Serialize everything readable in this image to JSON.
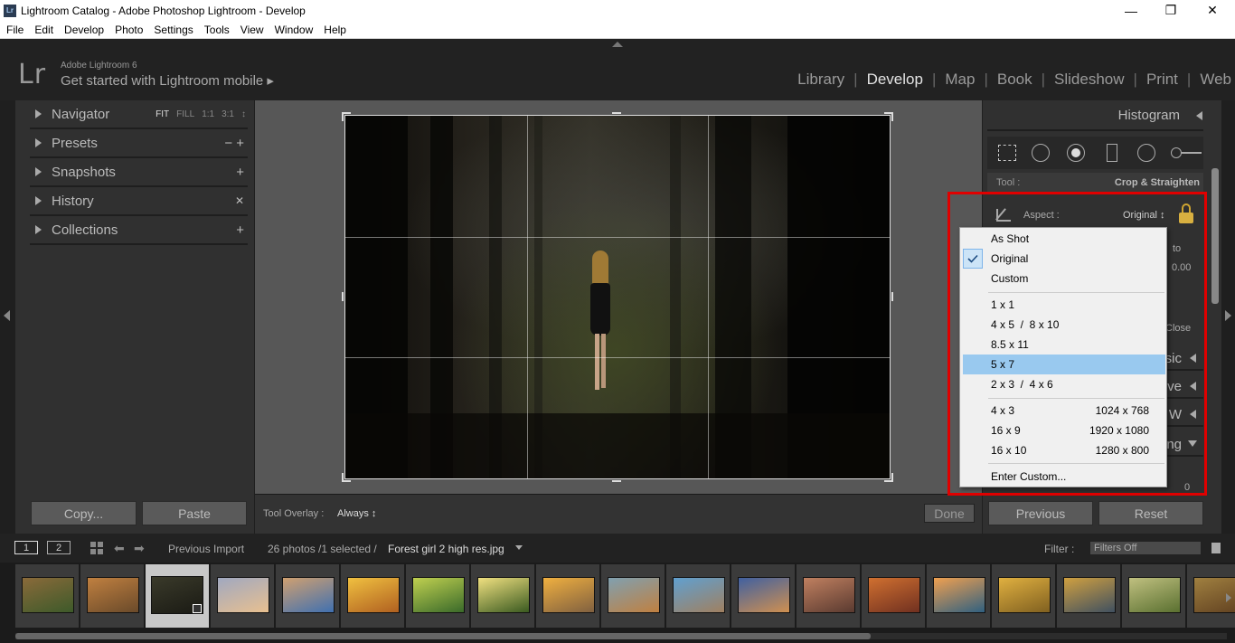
{
  "window": {
    "icon_text": "Lr",
    "title": "Lightroom Catalog - Adobe Photoshop Lightroom - Develop",
    "minimize": "—",
    "restore": "❐",
    "close": "✕"
  },
  "menu": [
    "File",
    "Edit",
    "Develop",
    "Photo",
    "Settings",
    "Tools",
    "View",
    "Window",
    "Help"
  ],
  "header": {
    "logo": "Lr",
    "brand": "Adobe Lightroom 6",
    "mobile_link": "Get started with Lightroom mobile ▸",
    "modules": [
      "Library",
      "Develop",
      "Map",
      "Book",
      "Slideshow",
      "Print",
      "Web"
    ],
    "active_module": "Develop"
  },
  "left_panel": {
    "navigator": {
      "label": "Navigator",
      "zoom": [
        "FIT",
        "FILL",
        "1:1",
        "3:1"
      ],
      "zoom_arrow": "↕"
    },
    "presets": {
      "label": "Presets",
      "actions": "−  +"
    },
    "snapshots": {
      "label": "Snapshots",
      "actions": "+"
    },
    "history": {
      "label": "History",
      "actions": "✕"
    },
    "collections": {
      "label": "Collections",
      "actions": "+"
    },
    "copy_button": "Copy...",
    "paste_button": "Paste"
  },
  "toolbar": {
    "overlay_label": "Tool Overlay :",
    "overlay_value": "Always ↕",
    "done_button": "Done"
  },
  "right_panel": {
    "histogram": "Histogram",
    "tool_label": "Tool :",
    "tool_name": "Crop & Straighten",
    "aspect_label": "Aspect :",
    "aspect_value": "Original ↕",
    "partial_to": "to",
    "partial_angle": "0.00",
    "partial_close": "Close",
    "partial_sections": [
      "sic",
      "ve",
      "W",
      "ng"
    ],
    "partial_value": "0",
    "previous_button": "Previous",
    "reset_button": "Reset"
  },
  "aspect_dropdown": {
    "group1": [
      {
        "label": "As Shot",
        "checked": false
      },
      {
        "label": "Original",
        "checked": true
      },
      {
        "label": "Custom",
        "checked": false
      }
    ],
    "group2": [
      {
        "label": "1 x 1"
      },
      {
        "label": "4 x 5  /  8 x 10"
      },
      {
        "label": "8.5 x 11"
      },
      {
        "label": "5 x 7",
        "highlighted": true
      },
      {
        "label": "2 x 3  /  4 x 6"
      }
    ],
    "group3": [
      {
        "label": "4 x 3",
        "resolution": "1024 x 768"
      },
      {
        "label": "16 x 9",
        "resolution": "1920 x 1080"
      },
      {
        "label": "16 x 10",
        "resolution": "1280 x 800"
      }
    ],
    "enter_custom": "Enter Custom...",
    "highlight_color": "#99c9ef",
    "annotation_color": "#e00000"
  },
  "filmbar": {
    "monitor1": "1",
    "monitor2": "2",
    "source": "Previous Import",
    "count": "26 photos /1 selected /",
    "filename": "Forest girl 2 high res.jpg",
    "filter_label": "Filter :",
    "filter_value": "Filters Off"
  },
  "filmstrip": {
    "thumb_colors": [
      [
        "#3d5a2a",
        "#8a6a3a"
      ],
      [
        "#6a4a2a",
        "#c08040"
      ],
      [
        "#1a1a14",
        "#3a3a2a"
      ],
      [
        "#e8c090",
        "#a0a8c0"
      ],
      [
        "#4070b0",
        "#d0a070"
      ],
      [
        "#b06020",
        "#f0c040"
      ],
      [
        "#3a6a2a",
        "#c0d050"
      ],
      [
        "#3a5a20",
        "#f0e080"
      ],
      [
        "#806040",
        "#f0b040"
      ],
      [
        "#c08040",
        "#80a0b0"
      ],
      [
        "#a08060",
        "#60a0d0"
      ],
      [
        "#d09050",
        "#4060a0"
      ],
      [
        "#5a3a30",
        "#c08060"
      ],
      [
        "#703020",
        "#d07030"
      ],
      [
        "#306080",
        "#f0a050"
      ],
      [
        "#806020",
        "#e0b040"
      ],
      [
        "#405060",
        "#d0a040"
      ],
      [
        "#5a7030",
        "#c0c080"
      ],
      [
        "#604020",
        "#a08040"
      ]
    ],
    "selected_index": 2
  }
}
